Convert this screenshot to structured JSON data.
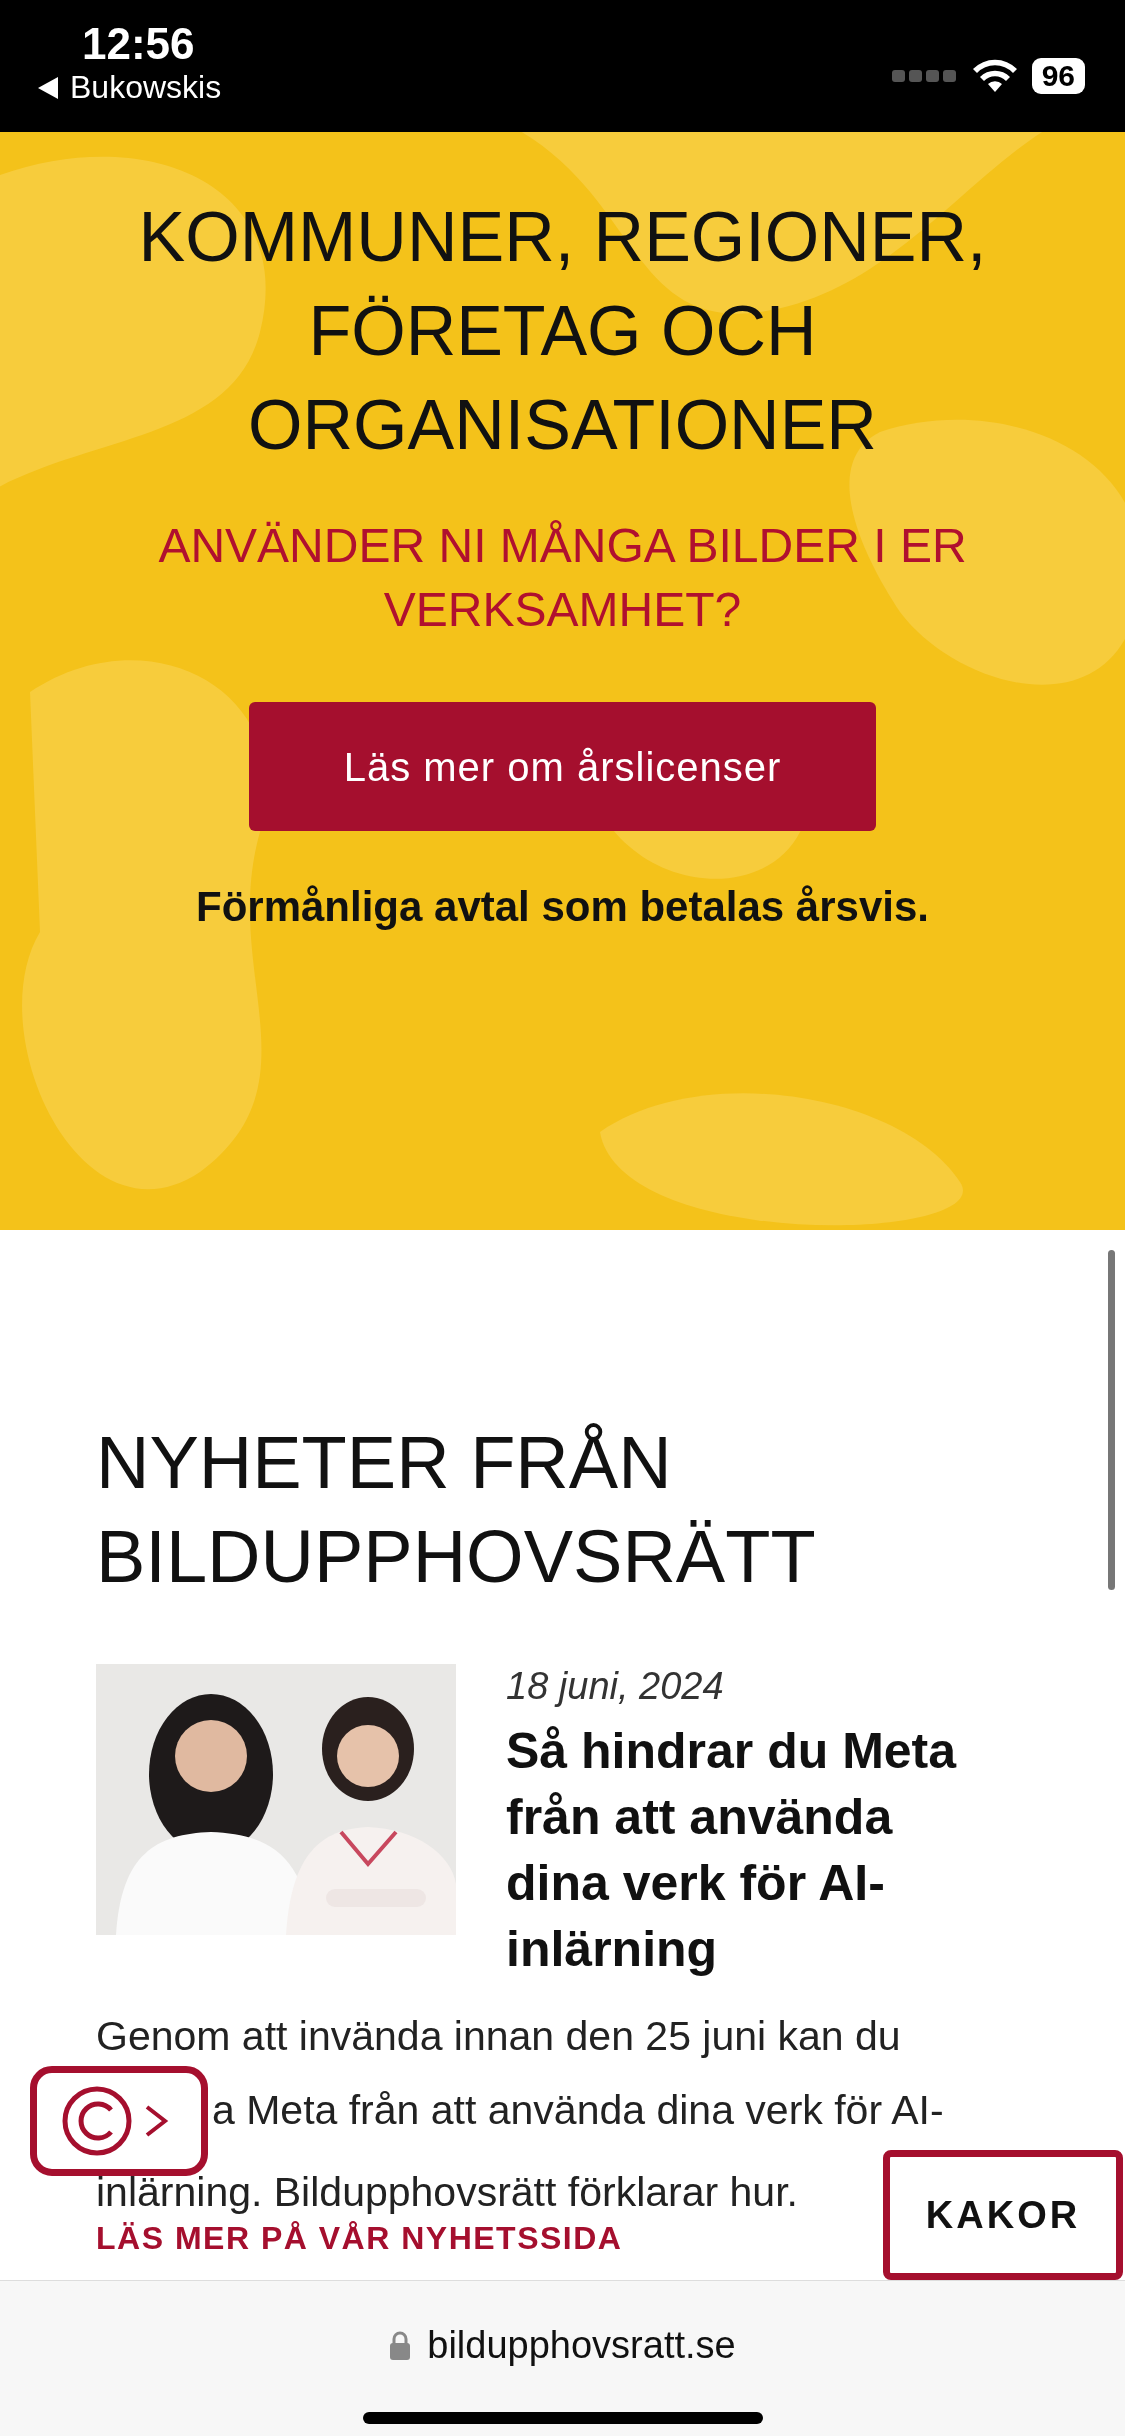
{
  "status_bar": {
    "time": "12:56",
    "back_app": "Bukowskis",
    "battery": "96"
  },
  "hero": {
    "title": "KOMMUNER, REGIONER, FÖRETAG OCH ORGANISATIONER",
    "subtitle": "ANVÄNDER NI MÅNGA BILDER I ER VERKSAMHET?",
    "button": "Läs mer om årslicenser",
    "note": "Förmånliga avtal som betalas årsvis."
  },
  "news": {
    "heading": "NYHETER FRÅN BILDUPPHOVSRÄTT",
    "articles": [
      {
        "date": "18 juni, 2024",
        "title": "Så hindrar du Meta från att använda dina verk för AI-inlärning",
        "summary_lines": [
          "Genom att invända innan den 25 juni kan du",
          "a Meta från att använda dina verk för AI-",
          "inlärning. Bildupphovsrätt förklarar hur."
        ],
        "link": "LÄS MER PÅ VÅR NYHETSSIDA"
      }
    ]
  },
  "cookie_button": "KAKOR",
  "browser": {
    "url": "bildupphovsratt.se"
  }
}
